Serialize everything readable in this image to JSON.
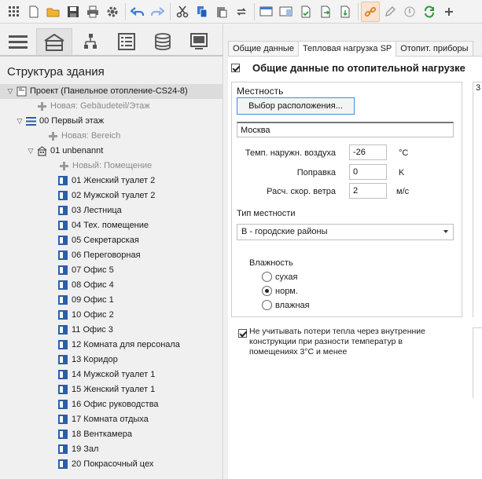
{
  "toolbar": {
    "buttons": [
      "grid-icon",
      "new-document-icon",
      "open-folder-icon",
      "save-icon",
      "print-icon",
      "settings-gear-icon",
      "undo-icon",
      "redo-icon",
      "cut-icon",
      "copy-icon",
      "paste-icon",
      "refresh-icon",
      "window-left-icon",
      "window-right-icon",
      "document-check-icon",
      "document-export-icon",
      "document-import-icon",
      "link-icon",
      "edit-pencil-icon",
      "info-icon",
      "sync-icon",
      "plus-icon"
    ],
    "active_button": "link-icon"
  },
  "left_panel": {
    "tabs": [
      "menu-icon",
      "building-icon",
      "network-icon",
      "list-icon",
      "database-icon",
      "screen-icon"
    ],
    "active_tab": 1,
    "title": "Структура здания",
    "tree": [
      {
        "label": "Проект (Панельное отопление-CS24-8)",
        "level": 0,
        "kind": "project",
        "toggle": "▽",
        "selected": true
      },
      {
        "label": "Новая: Gebäudeteil/Этаж",
        "level": 1,
        "kind": "new"
      },
      {
        "label": "00 Первый этаж",
        "level": 1,
        "kind": "floor",
        "toggle": "▽"
      },
      {
        "label": "Новая: Bereich",
        "level": 2,
        "kind": "new"
      },
      {
        "label": "01 unbenannt",
        "level": 2,
        "kind": "area",
        "toggle": "▽"
      },
      {
        "label": "Новый: Помещение",
        "level": 3,
        "kind": "new"
      },
      {
        "label": "01 Женский туалет 2",
        "level": 3,
        "kind": "room"
      },
      {
        "label": "02 Мужской туалет 2",
        "level": 3,
        "kind": "room"
      },
      {
        "label": "03 Лестница",
        "level": 3,
        "kind": "room"
      },
      {
        "label": "04 Тех. помещение",
        "level": 3,
        "kind": "room"
      },
      {
        "label": "05 Секретарская",
        "level": 3,
        "kind": "room"
      },
      {
        "label": "06 Переговорная",
        "level": 3,
        "kind": "room"
      },
      {
        "label": "07 Офис 5",
        "level": 3,
        "kind": "room"
      },
      {
        "label": "08 Офис 4",
        "level": 3,
        "kind": "room"
      },
      {
        "label": "09 Офис 1",
        "level": 3,
        "kind": "room"
      },
      {
        "label": "10 Офис 2",
        "level": 3,
        "kind": "room"
      },
      {
        "label": "11 Офис 3",
        "level": 3,
        "kind": "room"
      },
      {
        "label": "12 Комната для персонала",
        "level": 3,
        "kind": "room"
      },
      {
        "label": "13 Коридор",
        "level": 3,
        "kind": "room"
      },
      {
        "label": "14 Мужской туалет 1",
        "level": 3,
        "kind": "room"
      },
      {
        "label": "15 Женский туалет 1",
        "level": 3,
        "kind": "room"
      },
      {
        "label": "16 Офис руководства",
        "level": 3,
        "kind": "room"
      },
      {
        "label": "17 Комната отдыха",
        "level": 3,
        "kind": "room"
      },
      {
        "label": "18 Венткамера",
        "level": 3,
        "kind": "room"
      },
      {
        "label": "19 Зал",
        "level": 3,
        "kind": "room"
      },
      {
        "label": "20 Покрасочный цех",
        "level": 3,
        "kind": "room"
      }
    ]
  },
  "right_panel": {
    "tabs": [
      {
        "label": "Общие данные",
        "active": false
      },
      {
        "label": "Тепловая нагрузка SP",
        "active": true
      },
      {
        "label": "Отопит. приборы",
        "active": false
      }
    ],
    "section_title": "Общие данные по отопительной нагрузке",
    "section_checked": true,
    "locality": {
      "group_title": "Местность",
      "choose_location_button": "Выбор расположения...",
      "city": "Москва",
      "outdoor_temp_label": "Темп. наружн. воздуха",
      "outdoor_temp_value": "-26",
      "outdoor_temp_unit": "°C",
      "correction_label": "Поправка",
      "correction_value": "0",
      "correction_unit": "K",
      "wind_label": "Расч. скор. ветра",
      "wind_value": "2",
      "wind_unit": "м/с",
      "terrain_label": "Тип местности",
      "terrain_value": "В - городские районы",
      "humidity_label": "Влажность",
      "humidity_options": [
        "сухая",
        "норм.",
        "влажная"
      ],
      "humidity_selected": 1
    },
    "ignore_internal_loss": {
      "checked": true,
      "label": "Не учитывать потери тепла через внутренние конструкции при разности температур в помещениях 3°C и менее"
    },
    "right_edge_digit": "3"
  }
}
